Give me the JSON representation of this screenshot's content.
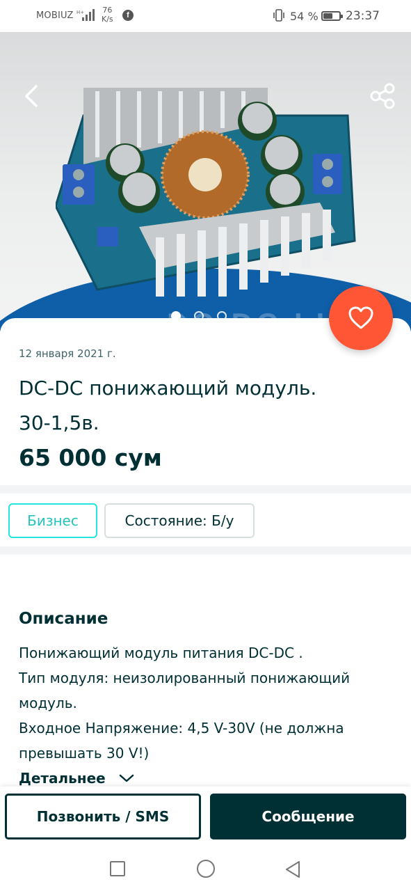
{
  "status_bar": {
    "carrier": "MOBIUZ",
    "speed_value": "76",
    "speed_unit": "K/s",
    "battery": "54 %",
    "time": "23:37"
  },
  "icons": {
    "back": "chevron-left-icon",
    "share": "share-icon",
    "favorite": "heart-icon",
    "more": "chevron-down-icon"
  },
  "gallery": {
    "image_count": 3,
    "active_index": 0,
    "banner_text": "DC-DC LI"
  },
  "listing": {
    "date": "12 января 2021 г.",
    "title": "DC-DC понижающий модуль. 30-1,5в.",
    "price": "65 000 сум"
  },
  "tags": {
    "business": "Бизнес",
    "state": "Состояние: Б/у"
  },
  "description": {
    "heading": "Описание",
    "lines": [
      "Понижающий модуль питания DC-DC .",
      "Тип модуля: неизолированный понижающий модуль.",
      "Входное Напряжение: 4,5 V-30V (не должна превышать 30 V!)"
    ],
    "more_label": "Детальнее"
  },
  "actions": {
    "call_label": "Позвонить / SMS",
    "message_label": "Сообщение"
  },
  "colors": {
    "primary": "#002f34",
    "accent": "#ff5636",
    "business": "#23e5db"
  }
}
